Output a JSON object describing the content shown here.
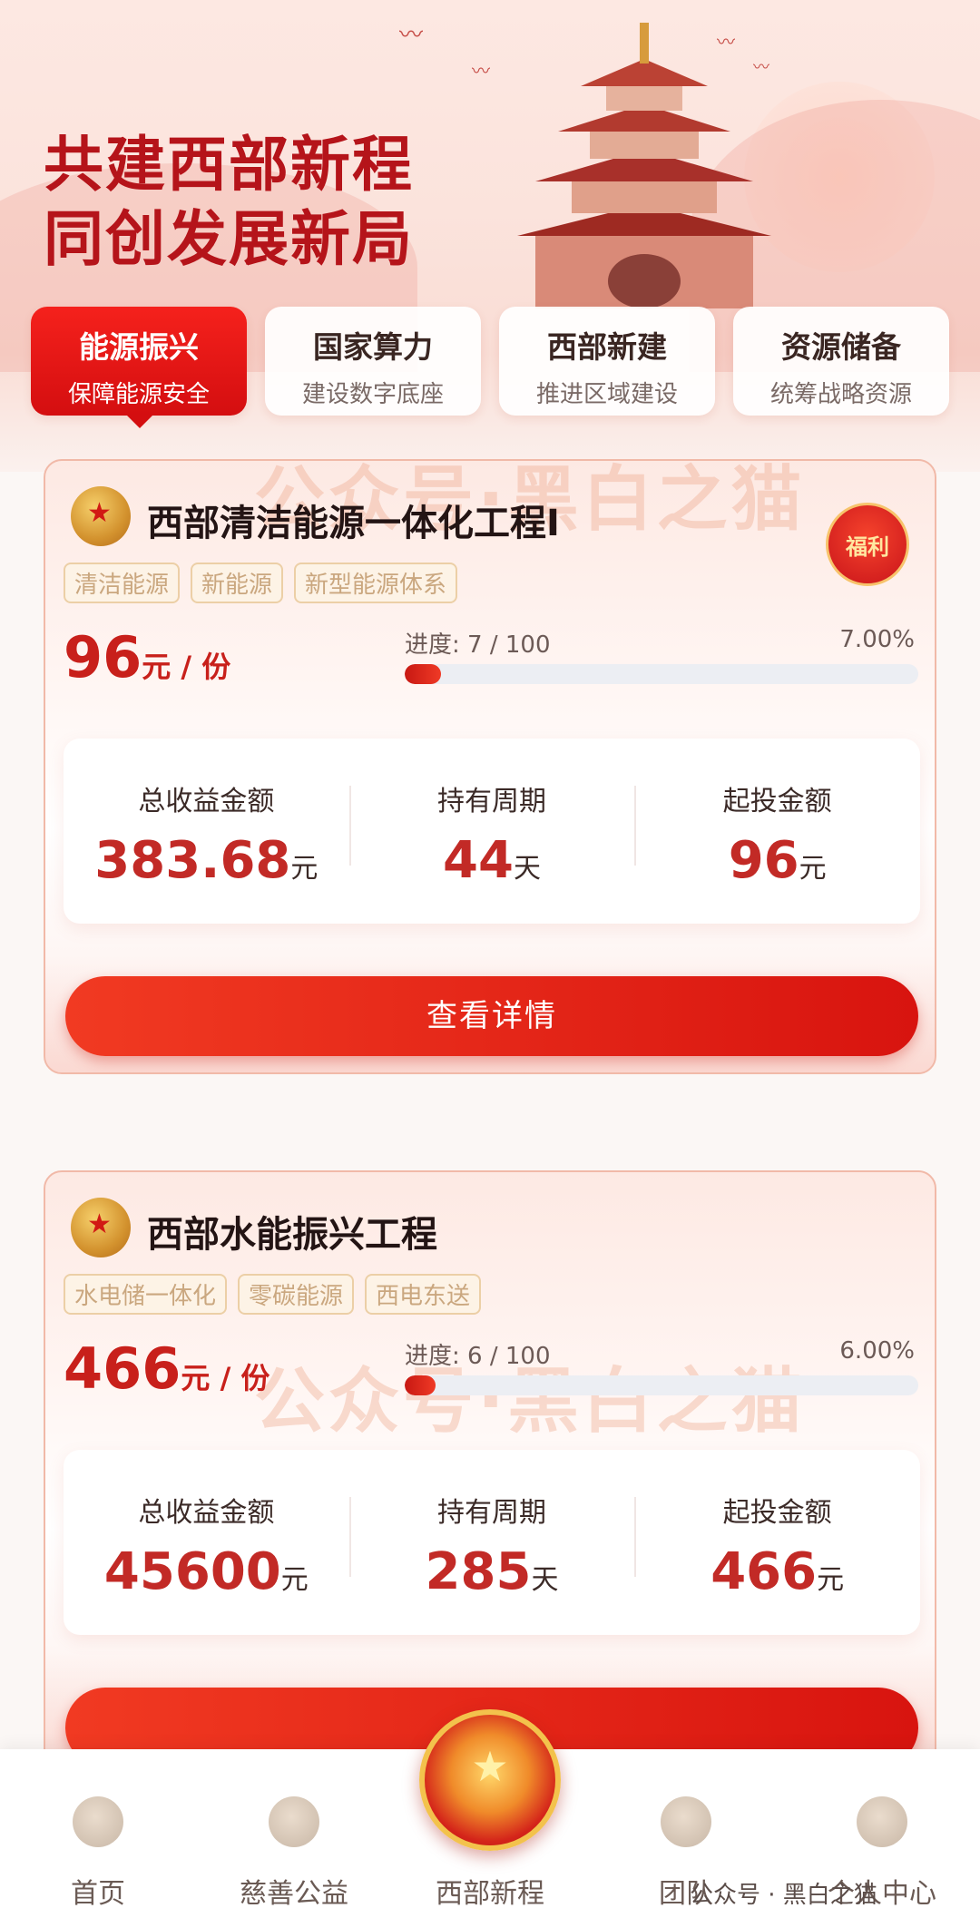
{
  "hero": {
    "headline_line1": "共建西部新程",
    "headline_line2": "同创发展新局"
  },
  "tabs": [
    {
      "title": "能源振兴",
      "subtitle": "保障能源安全",
      "active": true
    },
    {
      "title": "国家算力",
      "subtitle": "建设数字底座",
      "active": false
    },
    {
      "title": "西部新建",
      "subtitle": "推进区域建设",
      "active": false
    },
    {
      "title": "资源储备",
      "subtitle": "统筹战略资源",
      "active": false
    }
  ],
  "watermark": "公众号·黑白之猫",
  "products": [
    {
      "title": "西部清洁能源一体化工程I",
      "badge": "福利",
      "tags": [
        "清洁能源",
        "新能源",
        "新型能源体系"
      ],
      "price": "96",
      "price_unit": "元 / 份",
      "progress_label": "进度:  7 / 100",
      "progress_percent_text": "7.00%",
      "progress_fraction": 0.07,
      "stats": [
        {
          "label": "总收益金额",
          "value": "383.68",
          "unit": "元"
        },
        {
          "label": "持有周期",
          "value": "44",
          "unit": "天"
        },
        {
          "label": "起投金额",
          "value": "96",
          "unit": "元"
        }
      ],
      "cta": "查看详情"
    },
    {
      "title": "西部水能振兴工程",
      "tags": [
        "水电储一体化",
        "零碳能源",
        "西电东送"
      ],
      "price": "466",
      "price_unit": "元 / 份",
      "progress_label": "进度:  6 / 100",
      "progress_percent_text": "6.00%",
      "progress_fraction": 0.06,
      "stats": [
        {
          "label": "总收益金额",
          "value": "45600",
          "unit": "元"
        },
        {
          "label": "持有周期",
          "value": "285",
          "unit": "天"
        },
        {
          "label": "起投金额",
          "value": "466",
          "unit": "元"
        }
      ]
    }
  ],
  "navbar": {
    "items": [
      {
        "label": "首页",
        "icon": "home-icon"
      },
      {
        "label": "慈善公益",
        "icon": "charity-icon"
      },
      {
        "label": "西部新程",
        "icon": "emblem-icon"
      },
      {
        "label": "团队",
        "icon": "team-icon"
      },
      {
        "label": "个人中心",
        "icon": "user-icon"
      }
    ]
  },
  "wechat_watermark": "公众号 · 黑白之猫",
  "colors": {
    "accent": "#d8140f",
    "headline": "#b5141a",
    "tag": "#caa77f"
  }
}
